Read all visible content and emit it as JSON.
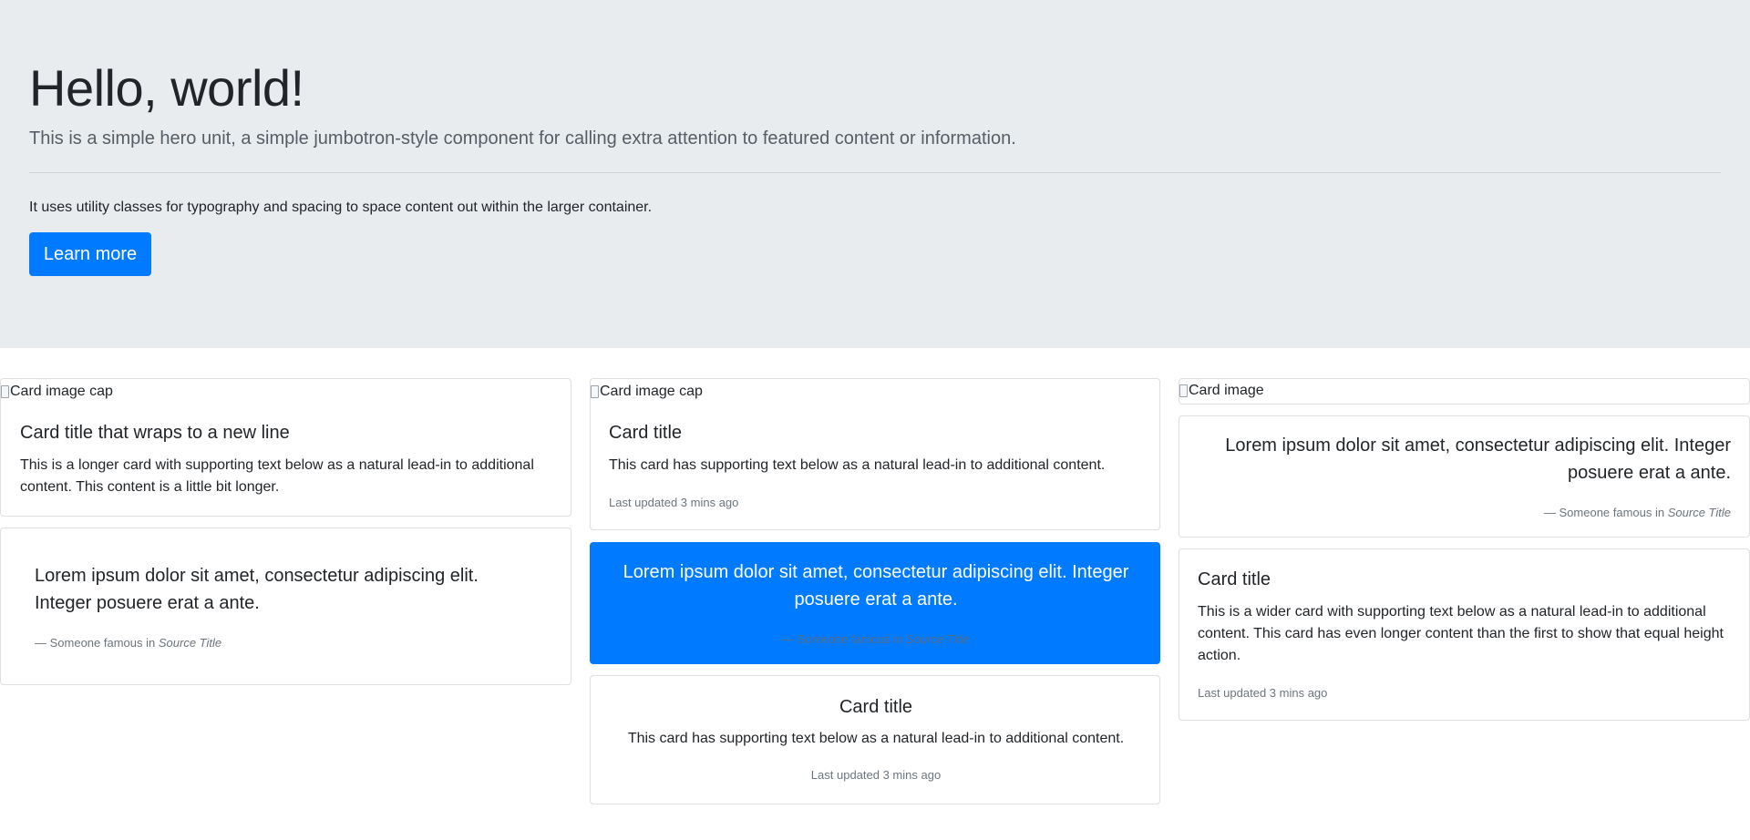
{
  "jumbotron": {
    "title": "Hello, world!",
    "lead": "This is a simple hero unit, a simple jumbotron-style component for calling extra attention to featured content or information.",
    "text": "It uses utility classes for typography and spacing to space content out within the larger container.",
    "button_label": "Learn more"
  },
  "cards": {
    "c1": {
      "img_alt": "Card image cap",
      "title": "Card title that wraps to a new line",
      "text": "This is a longer card with supporting text below as a natural lead-in to additional content. This content is a little bit longer."
    },
    "c2": {
      "quote": "Lorem ipsum dolor sit amet, consectetur adipiscing elit. Integer posuere erat a ante.",
      "footer_prefix": "— Someone famous in ",
      "footer_source": "Source Title"
    },
    "c3": {
      "img_alt": "Card image cap",
      "title": "Card title",
      "text": "This card has supporting text below as a natural lead-in to additional content.",
      "muted": "Last updated 3 mins ago"
    },
    "c4": {
      "quote": "Lorem ipsum dolor sit amet, consectetur adipiscing elit. Integer posuere erat a ante.",
      "footer_prefix": "— Someone famous in ",
      "footer_source": "Source Title",
      "bg_color": "#007bff"
    },
    "c5": {
      "title": "Card title",
      "text": "This card has supporting text below as a natural lead-in to additional content.",
      "muted": "Last updated 3 mins ago"
    },
    "c6": {
      "img_alt": "Card image"
    },
    "c7": {
      "quote": "Lorem ipsum dolor sit amet, consectetur adipiscing elit. Integer posuere erat a ante.",
      "footer_prefix": "— Someone famous in ",
      "footer_source": "Source Title"
    },
    "c8": {
      "title": "Card title",
      "text": "This is a wider card with supporting text below as a natural lead-in to additional content. This card has even longer content than the first to show that equal height action.",
      "muted": "Last updated 3 mins ago"
    }
  }
}
